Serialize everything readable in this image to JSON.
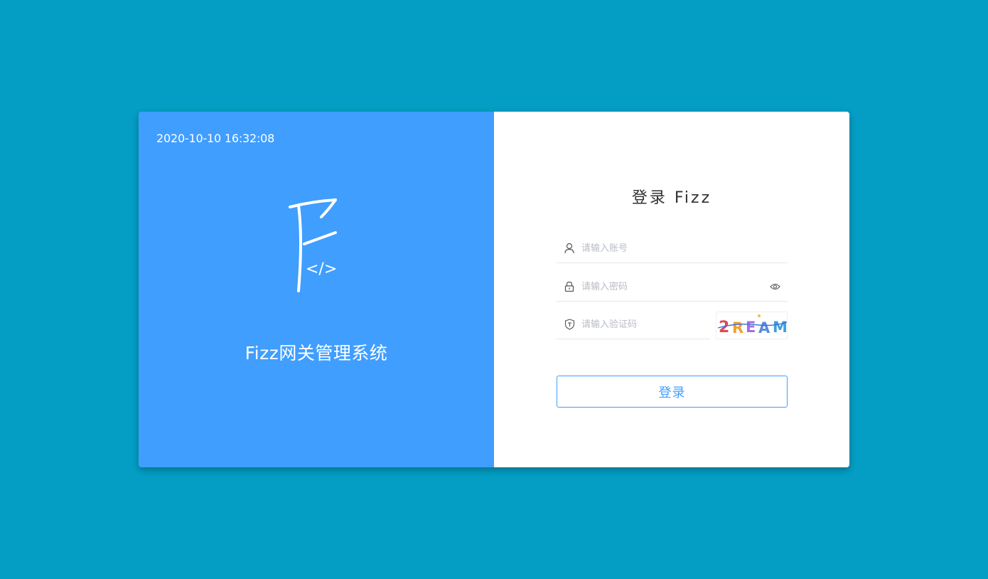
{
  "left_panel": {
    "datetime": "2020-10-10 16:32:08",
    "logo_letter": "F",
    "logo_code": "</>",
    "system_title": "Fizz网关管理系统",
    "background_color": "#409EFF"
  },
  "login_form": {
    "title": "登录 Fizz",
    "username": {
      "placeholder": "请输入账号",
      "icon": "user-icon"
    },
    "password": {
      "placeholder": "请输入密码",
      "icon": "lock-icon",
      "toggle_icon": "eye-icon"
    },
    "captcha": {
      "placeholder": "请输入验证码",
      "icon": "shield-icon",
      "image_text": "2REAM"
    },
    "submit_label": "登录",
    "accent_color": "#409EFF"
  },
  "page_background": "#049EC4"
}
